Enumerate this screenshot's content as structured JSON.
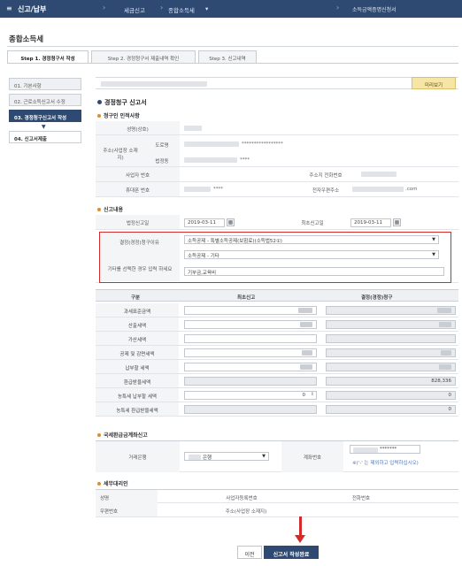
{
  "topbar": {
    "menu_title": "신고/납부",
    "crumb1": "세금신고",
    "crumb2": "종합소득세",
    "crumb2_arrow": "▾",
    "right_link": "소득금액증명신청서"
  },
  "page_title": "종합소득세",
  "tabs": [
    {
      "label": "Step 1. 경정청구서 작성"
    },
    {
      "label": "Step 2. 경정청구서 제출내역 확인"
    },
    {
      "label": "Step 3. 신고내역"
    }
  ],
  "sidebar": [
    {
      "label": "01. 기본사항"
    },
    {
      "label": "02. 근로소득신고서 수정"
    },
    {
      "label": "03. 경정청구신고서 작성"
    },
    {
      "label": "04. 신고서제출"
    }
  ],
  "preview_button": "미리보기",
  "section_title": "경정청구 신고서",
  "claimant": {
    "title": "청구인 인적사항",
    "name_label": "성명(상호)",
    "address_label": "주소(사업장 소재지)",
    "road_label": "도로명",
    "lot_label": "법정동",
    "road_masked": "*****************",
    "lot_masked": "****",
    "bizno_label": "사업자 번호",
    "phone_label": "주소지 전화번호",
    "mobile_label": "휴대폰 번호",
    "mobile_masked": "****",
    "email_label": "전자우편주소",
    "email_suffix": ".com"
  },
  "filing": {
    "title": "신고내용",
    "legal_date_label": "법정신고일",
    "legal_date": "2019-03-11",
    "initial_date_label": "최초신고일",
    "initial_date": "2019-03-11",
    "reason_label": "결정(경정)청구이유",
    "reason1": "소득공제 - 특별소득공제(보험료)(소득법52①)",
    "reason2": "소득공제 - 기타",
    "other_label": "기타를 선택한 경우 입력 하세요",
    "other_value": "기부금,교육비",
    "calendar_icon": "▦"
  },
  "table": {
    "col1": "구분",
    "col2": "최초신고",
    "col3": "결정(경정)청구",
    "rows": [
      {
        "label": "과세표준금액",
        "initial": "",
        "claim": ""
      },
      {
        "label": "산출세액",
        "initial": "",
        "claim": ""
      },
      {
        "label": "가산세액",
        "initial": "",
        "claim": ""
      },
      {
        "label": "공제 및 감면세액",
        "initial": "",
        "claim": ""
      },
      {
        "label": "납부할 세액",
        "initial": "",
        "claim": ""
      },
      {
        "label": "환급받을세액",
        "initial": "",
        "claim": "828,336"
      },
      {
        "label": "농특세 납부할 세액",
        "initial": "0",
        "claim": "0"
      },
      {
        "label": "농특세 환급받을세액",
        "initial": "",
        "claim": "0"
      }
    ]
  },
  "refund": {
    "title": "국세환급금계좌신고",
    "bank_label": "거래은행",
    "bank_value": "은행",
    "account_label": "계좌번호",
    "account_masked": "*******",
    "note": "※('-' 는 제외하고 입력하십시오)"
  },
  "agent": {
    "title": "세무대리인",
    "name_label": "성명",
    "bizno_label": "사업자등록번호",
    "phone_label": "전화번호",
    "zip_label": "우편번호",
    "addr_label": "주소(사업장 소재지)"
  },
  "buttons": {
    "prev": "이전",
    "done": "신고서 작성완료"
  }
}
